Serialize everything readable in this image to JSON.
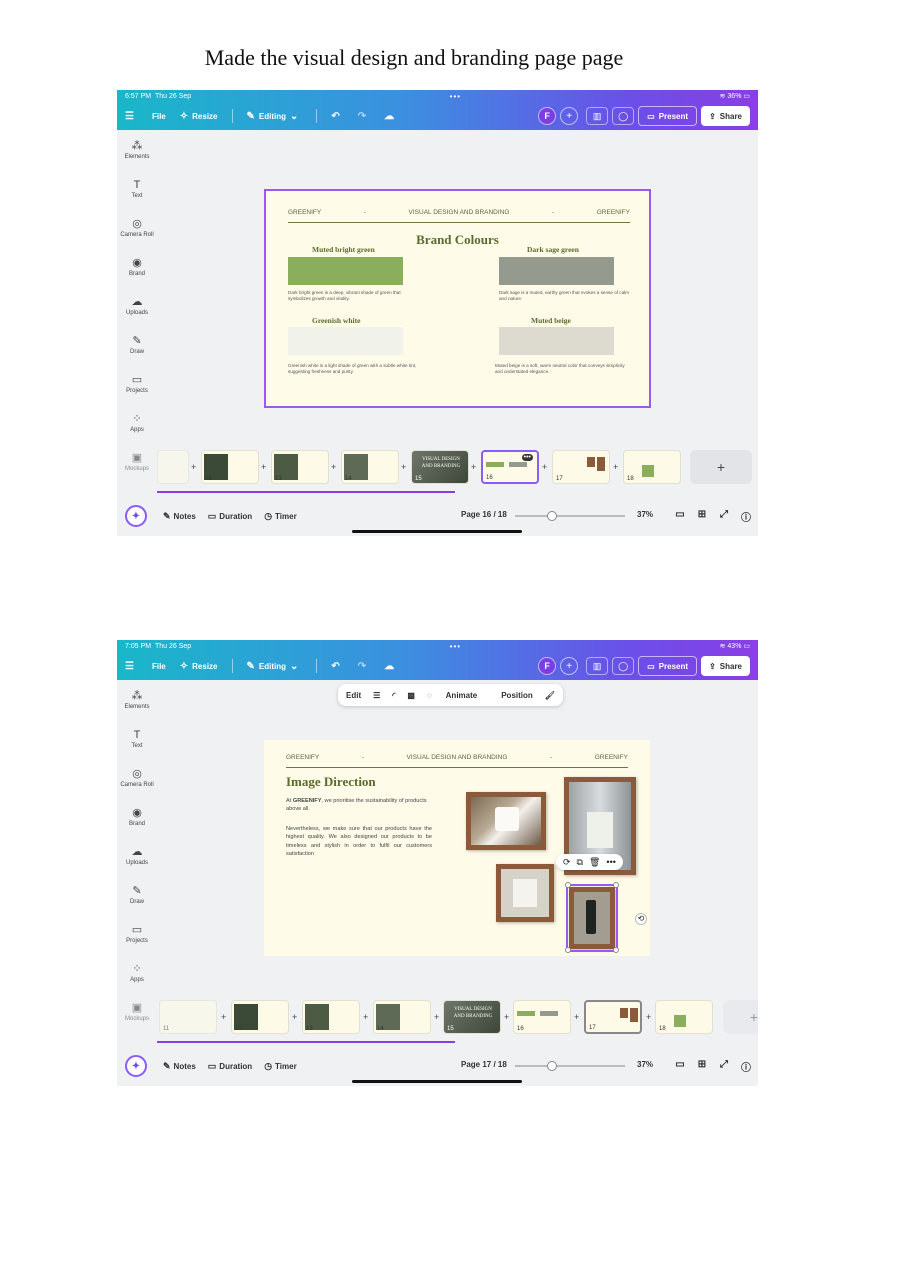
{
  "page_title": "Made the visual design and branding page page",
  "shot1": {
    "status": {
      "time": "6:57 PM",
      "date": "Thu 26 Sep",
      "battery": "36%"
    },
    "toolbar": {
      "file": "File",
      "resize": "Resize",
      "editing": "Editing",
      "avatar": "F",
      "present": "Present",
      "share": "Share"
    },
    "sidebar": [
      "Elements",
      "Text",
      "Camera Roll",
      "Brand",
      "Uploads",
      "Draw",
      "Projects",
      "Apps",
      "Mockups"
    ],
    "slide": {
      "header_left": "GREENIFY",
      "header_mid": "VISUAL DESIGN AND BRANDING",
      "header_right": "GREENIFY",
      "header_dash1": "-",
      "header_dash2": "-",
      "title": "Brand Colours",
      "swatches": [
        {
          "label": "Muted bright green",
          "color": "#8aae5c",
          "desc": "Dark bright green is a deep, vibrant shade of green that symbolizes growth and vitality."
        },
        {
          "label": "Dark sage green",
          "color": "#949a8e",
          "desc": "Dark sage is a muted, earthy green that evokes a sense of calm and nature."
        },
        {
          "label": "Greenish white",
          "color": "#f1f2ea",
          "desc": "Greenish white is a light shade of green with a subtle white tint, suggesting freshness and purity."
        },
        {
          "label": "Muted beige",
          "color": "#dddad0",
          "desc": "Muted beige is a soft, warm neutral color that conveys simplicity and understated elegance."
        }
      ]
    },
    "thumbs": [
      "12",
      "13",
      "14",
      "15",
      "16",
      "17",
      "18"
    ],
    "thumb15_text": "VISUAL DESIGN AND BRANDING",
    "bottom": {
      "notes": "Notes",
      "duration": "Duration",
      "timer": "Timer",
      "page": "Page 16 / 18",
      "zoom": "37%"
    },
    "zoom_fraction": 0.37
  },
  "shot2": {
    "status": {
      "time": "7:05 PM",
      "date": "Thu 26 Sep",
      "battery": "43%"
    },
    "toolbar": {
      "file": "File",
      "resize": "Resize",
      "editing": "Editing",
      "avatar": "F",
      "present": "Present",
      "share": "Share"
    },
    "ctx_toolbar": {
      "edit": "Edit",
      "animate": "Animate",
      "position": "Position"
    },
    "sidebar": [
      "Elements",
      "Text",
      "Camera Roll",
      "Brand",
      "Uploads",
      "Draw",
      "Projects",
      "Apps",
      "Mockups"
    ],
    "slide": {
      "header_left": "GREENIFY",
      "header_mid": "VISUAL DESIGN AND BRANDING",
      "header_right": "GREENIFY",
      "header_dash1": "-",
      "header_dash2": "-",
      "title": "Image Direction",
      "para1_pre": "At ",
      "para1_brand": "GREENIFY",
      "para1_post": ", we prioritise the sustainability of products above all.",
      "para2": "Nevertheless, we make sure that our products have the highest quality. We also designed our products to be timeless and stylish in order to fulfil our customers satisfaction"
    },
    "thumbs": [
      "11",
      "12",
      "13",
      "14",
      "15",
      "16",
      "17",
      "18"
    ],
    "thumb15_text": "VISUAL DESIGN AND BRANDING",
    "bottom": {
      "notes": "Notes",
      "duration": "Duration",
      "timer": "Timer",
      "page": "Page 17 / 18",
      "zoom": "37%"
    },
    "zoom_fraction": 0.37
  },
  "colors": {
    "brand_green": "#5a6b2c",
    "accent_purple": "#8b5cf6",
    "slide_bg": "#fefbe9"
  }
}
